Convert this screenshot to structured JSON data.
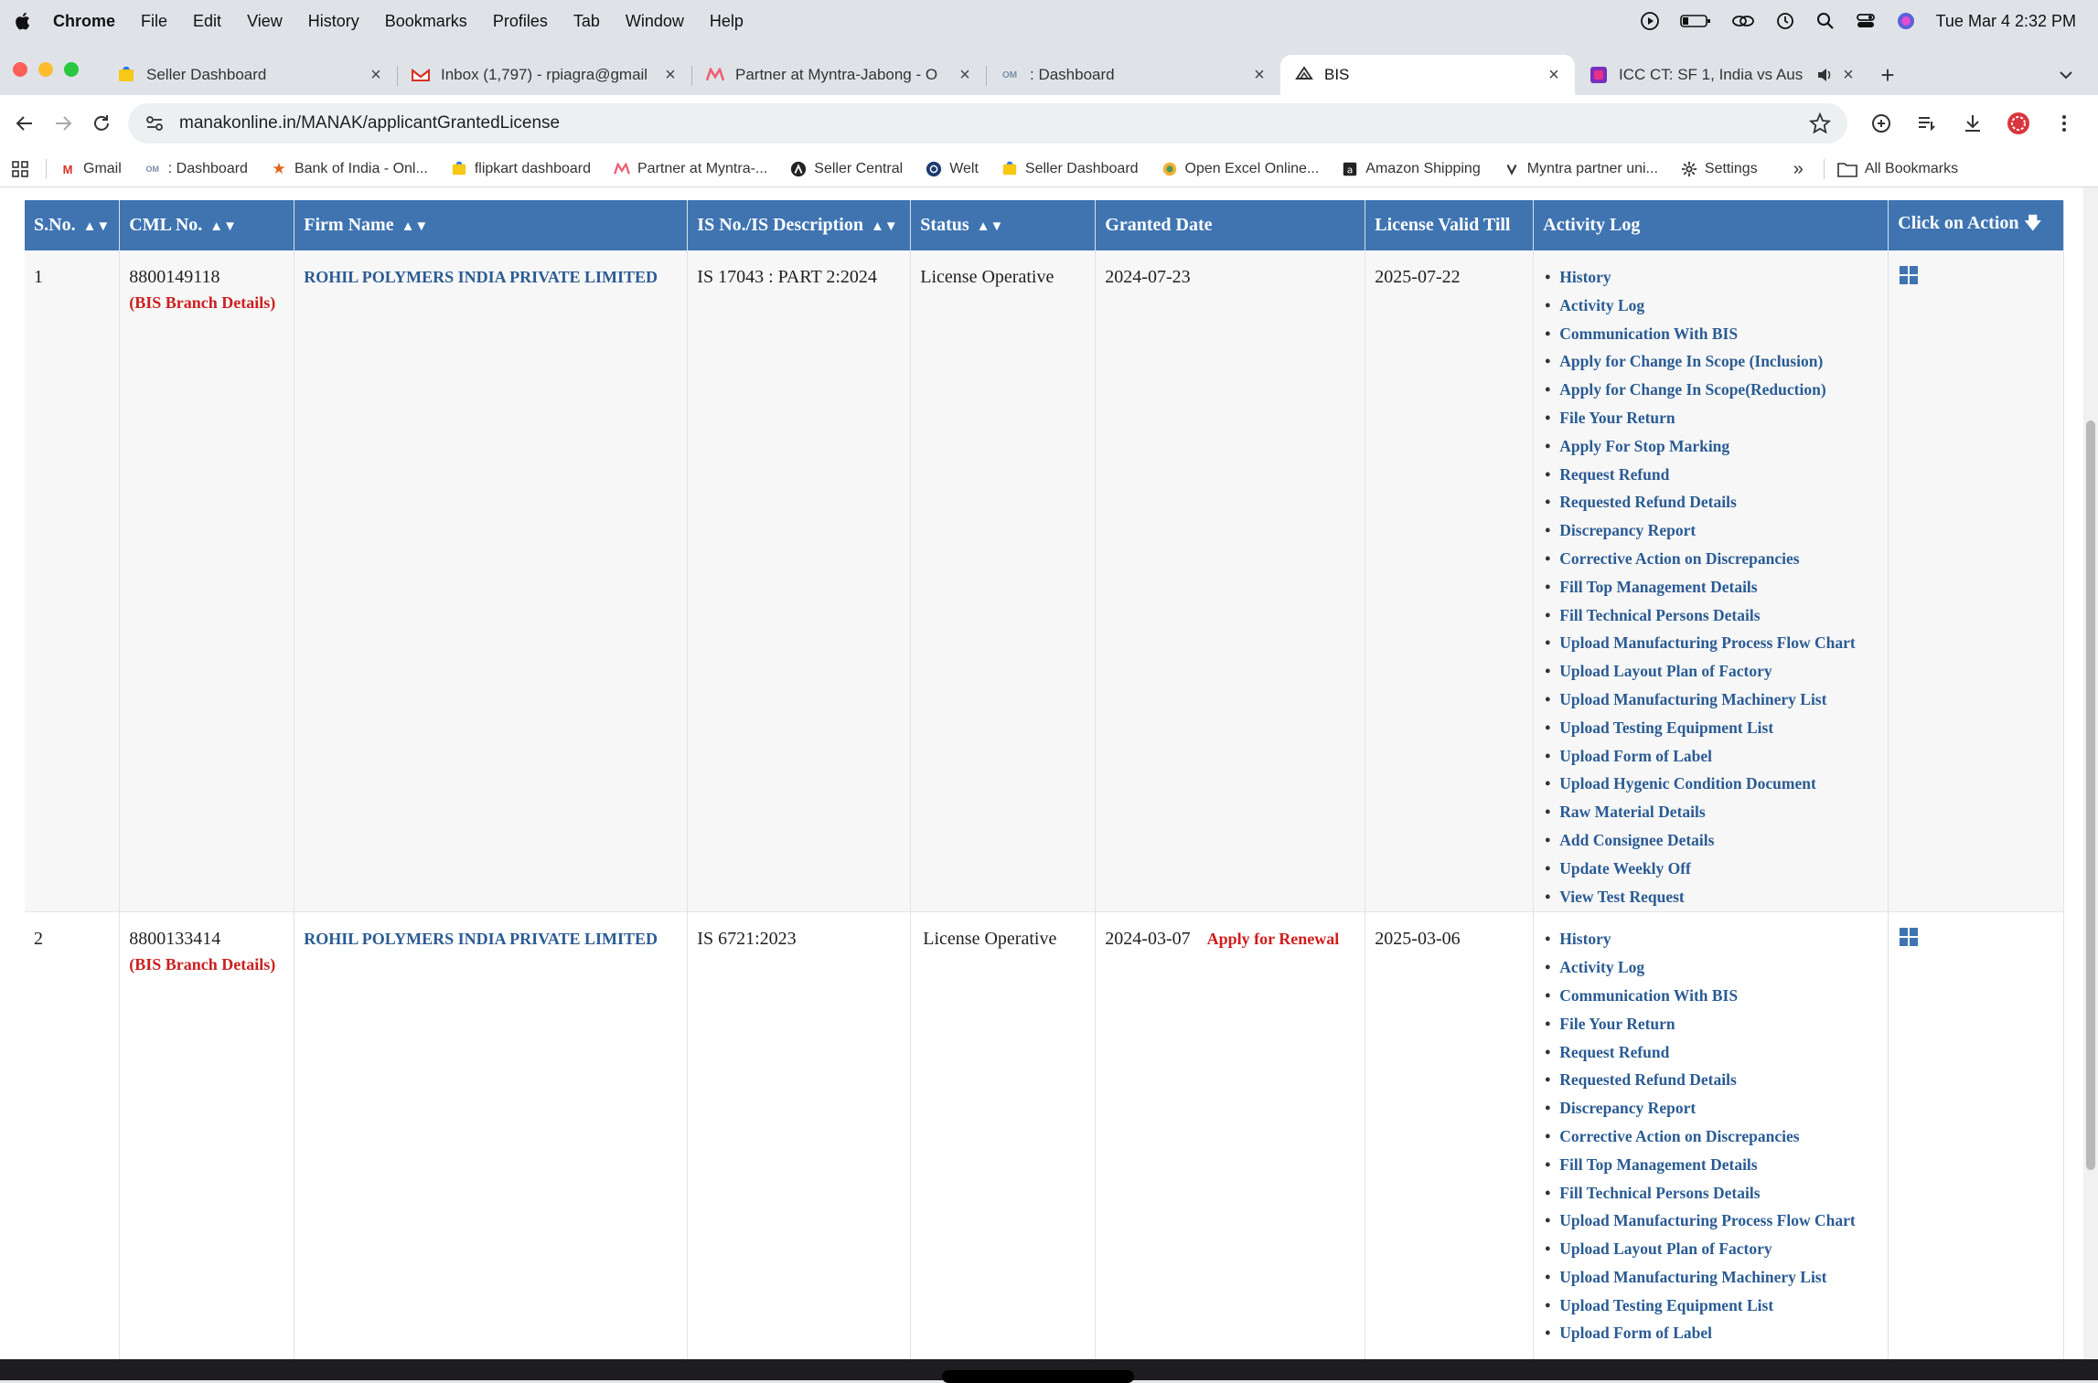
{
  "menubar": {
    "items": [
      "Chrome",
      "File",
      "Edit",
      "View",
      "History",
      "Bookmarks",
      "Profiles",
      "Tab",
      "Window",
      "Help"
    ],
    "clock": "Tue Mar 4  2:32 PM"
  },
  "tabs": [
    {
      "title": "Seller Dashboard",
      "icon": "flipkart-icon",
      "active": false
    },
    {
      "title": "Inbox (1,797) - rpiagra@gmail",
      "icon": "gmail-icon",
      "active": false
    },
    {
      "title": "Partner at Myntra-Jabong - O",
      "icon": "myntra-icon",
      "active": false
    },
    {
      "title": ": Dashboard",
      "icon": "omnichannel-icon",
      "active": false
    },
    {
      "title": "BIS",
      "icon": "bis-icon",
      "active": true
    },
    {
      "title": "ICC CT: SF 1, India vs Aus",
      "icon": "icc-icon",
      "active": false
    }
  ],
  "address": {
    "url": "manakonline.in/MANAK/applicantGrantedLicense"
  },
  "bookmarks": {
    "items": [
      {
        "label": "Gmail",
        "icon": "gmail-icon"
      },
      {
        "label": ": Dashboard",
        "icon": "omnichannel-icon"
      },
      {
        "label": "Bank of India - Onl...",
        "icon": "bank-star-icon"
      },
      {
        "label": "flipkart dashboard",
        "icon": "flipkart-icon"
      },
      {
        "label": "Partner at Myntra-...",
        "icon": "myntra-icon"
      },
      {
        "label": "Seller Central",
        "icon": "seller-central-icon"
      },
      {
        "label": "Welt",
        "icon": "welt-icon"
      },
      {
        "label": "Seller Dashboard",
        "icon": "flipkart-icon"
      },
      {
        "label": "Open Excel Online...",
        "icon": "excel-icon"
      },
      {
        "label": "Amazon Shipping",
        "icon": "amazon-icon"
      },
      {
        "label": "Myntra partner uni...",
        "icon": "myntra-partner-icon"
      },
      {
        "label": "Settings",
        "icon": "gear-icon"
      }
    ],
    "all_label": "All Bookmarks"
  },
  "table": {
    "headers": {
      "sno": "S.No.",
      "cml": "CML No.",
      "firm": "Firm Name",
      "isno": "IS No./IS Description",
      "status": "Status",
      "granted": "Granted Date",
      "valid": "License Valid Till",
      "activity": "Activity Log",
      "action": "Click on Action"
    },
    "rows": [
      {
        "sno": "1",
        "cml": "8800149118",
        "branch": "(BIS Branch Details)",
        "firm": "ROHIL POLYMERS INDIA PRIVATE LIMITED",
        "isno": "IS 17043 : PART 2:2024",
        "status": "License Operative",
        "granted": "2024-07-23",
        "renewal": "",
        "valid": "2025-07-22",
        "activities": [
          "History",
          "Activity Log",
          "Communication With BIS",
          "Apply for Change In Scope (Inclusion)",
          "Apply for Change In Scope(Reduction)",
          "File Your Return",
          "Apply For Stop Marking",
          "Request Refund",
          "Requested Refund Details",
          "Discrepancy Report",
          "Corrective Action on Discrepancies",
          "Fill Top Management Details",
          "Fill Technical Persons Details",
          "Upload Manufacturing Process Flow Chart",
          "Upload Layout Plan of Factory",
          "Upload Manufacturing Machinery List",
          "Upload Testing Equipment List",
          "Upload Form of Label",
          "Upload Hygenic Condition Document",
          "Raw Material Details",
          "Add Consignee Details",
          "Update Weekly Off",
          "View Test Request"
        ]
      },
      {
        "sno": "2",
        "cml": "8800133414",
        "branch": "(BIS Branch Details)",
        "firm": "ROHIL POLYMERS INDIA PRIVATE LIMITED",
        "isno": "IS 6721:2023",
        "status": "License Operative",
        "granted": "2024-03-07",
        "renewal": "Apply for Renewal",
        "valid": "2025-03-06",
        "activities": [
          "History",
          "Activity Log",
          "Communication With BIS",
          "File Your Return",
          "Request Refund",
          "Requested Refund Details",
          "Discrepancy Report",
          "Corrective Action on Discrepancies",
          "Fill Top Management Details",
          "Fill Technical Persons Details",
          "Upload Manufacturing Process Flow Chart",
          "Upload Layout Plan of Factory",
          "Upload Manufacturing Machinery List",
          "Upload Testing Equipment List",
          "Upload Form of Label"
        ]
      }
    ]
  },
  "colors": {
    "header_bg": "#3f74b1",
    "link": "#2a5b93",
    "branch_red": "#cc1f1f",
    "renew_red": "#d01c1c"
  }
}
